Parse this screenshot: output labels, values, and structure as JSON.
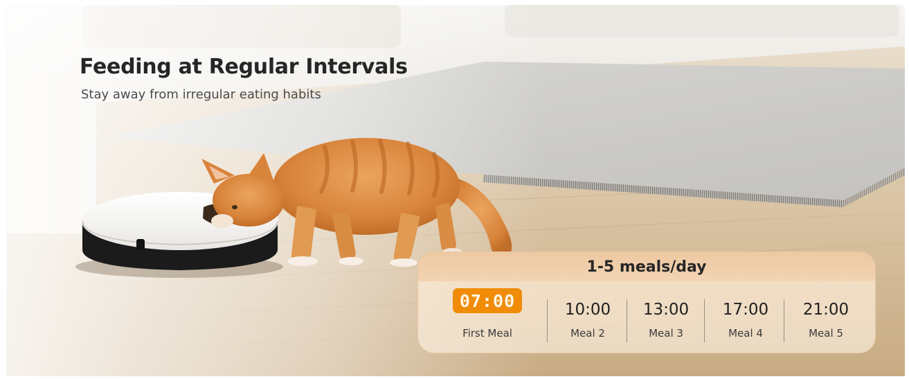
{
  "headline": "Feeding at Regular Intervals",
  "subheadline": "Stay away from irregular eating habits",
  "schedule": {
    "title": "1-5 meals/day",
    "highlight_color": "#f08c08",
    "meals": [
      {
        "time": "07:00",
        "label": "First Meal"
      },
      {
        "time": "10:00",
        "label": "Meal 2"
      },
      {
        "time": "13:00",
        "label": "Meal 3"
      },
      {
        "time": "17:00",
        "label": "Meal 4"
      },
      {
        "time": "21:00",
        "label": "Meal 5"
      }
    ]
  }
}
